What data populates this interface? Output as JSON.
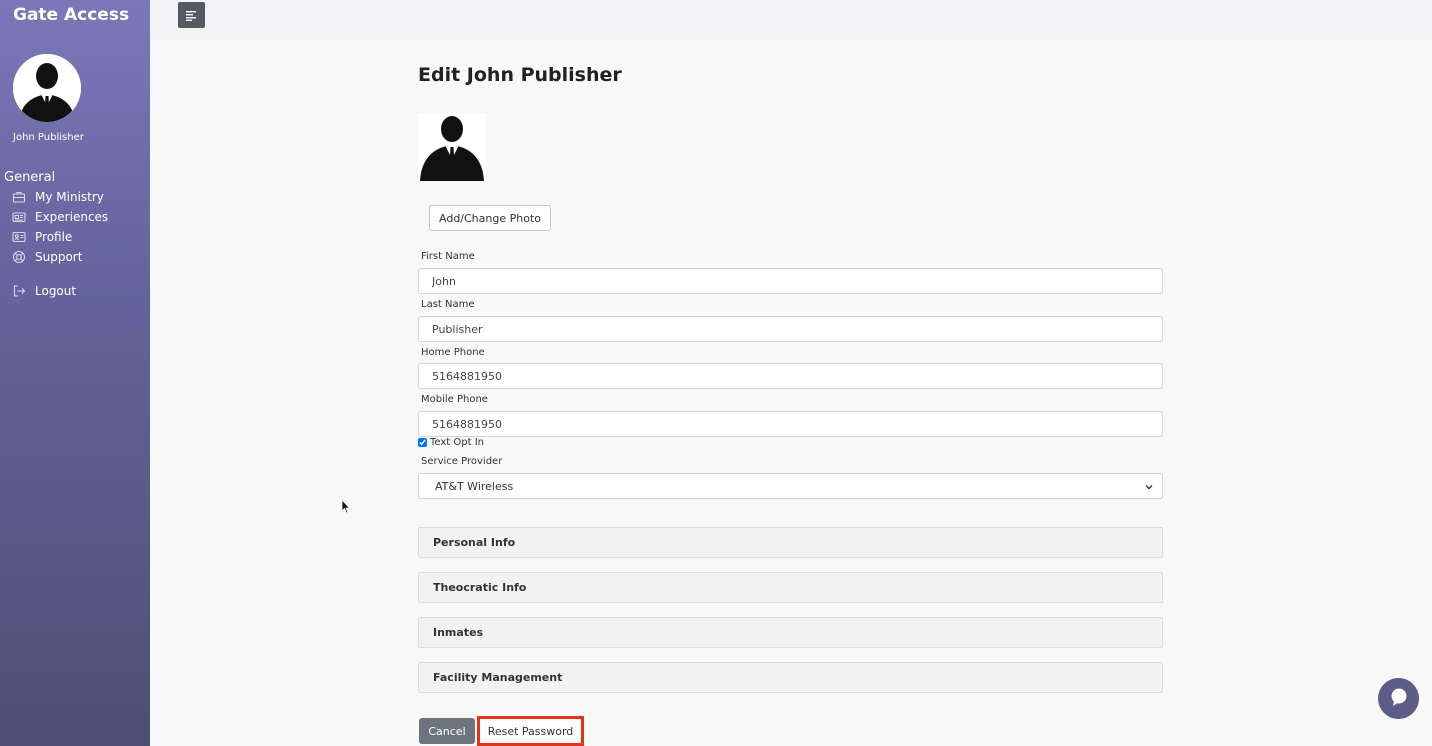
{
  "app": {
    "title": "Gate Access"
  },
  "sidebar": {
    "user_name": "John Publisher",
    "section": "General",
    "items": [
      {
        "label": "My Ministry",
        "icon": "briefcase-icon"
      },
      {
        "label": "Experiences",
        "icon": "newspaper-icon"
      },
      {
        "label": "Profile",
        "icon": "id-card-icon"
      },
      {
        "label": "Support",
        "icon": "life-ring-icon"
      },
      {
        "label": "Logout",
        "icon": "sign-out-icon"
      }
    ]
  },
  "topbar": {
    "menu_icon": "menu-icon"
  },
  "main": {
    "title": "Edit John Publisher",
    "photo_button": "Add/Change Photo",
    "fields": {
      "first_name": {
        "label": "First Name",
        "value": "John"
      },
      "last_name": {
        "label": "Last Name",
        "value": "Publisher"
      },
      "home_phone": {
        "label": "Home Phone",
        "value": "5164881950"
      },
      "mobile_phone": {
        "label": "Mobile Phone",
        "value": "5164881950"
      }
    },
    "text_opt_in": {
      "label": "Text Opt In",
      "checked": true
    },
    "service_provider": {
      "label": "Service Provider",
      "selected": "AT&T Wireless"
    },
    "panels": [
      "Personal Info",
      "Theocratic Info",
      "Inmates",
      "Facility Management"
    ],
    "cancel_label": "Cancel",
    "reset_label": "Reset Password"
  },
  "colors": {
    "sidebar_top": "#7a78b8",
    "sidebar_bottom": "#4f4e74",
    "highlight": "#e8321c",
    "chat": "#5c5d87"
  }
}
